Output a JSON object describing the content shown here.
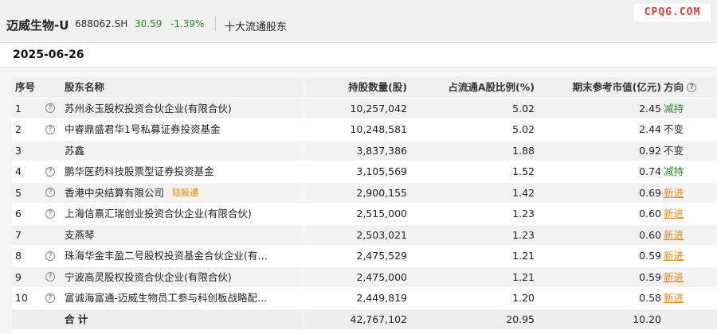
{
  "header": {
    "name": "迈威生物-U",
    "code": "688062.SH",
    "price": "30.59",
    "change_pct": "-1.39%",
    "section": "十大流通股东",
    "watermark": "CPQG.COM"
  },
  "report_date": "2025-06-26",
  "columns": {
    "index": "序号",
    "holder": "股东名称",
    "shares": "持股数量(股)",
    "ratio": "占流通A股比例(%)",
    "value": "期末参考市值(亿元)",
    "direction": "方向"
  },
  "rows": [
    {
      "index": "1",
      "holder": "苏州永玉股权投资合伙企业(有限合伙)",
      "shares": "10,257,042",
      "ratio": "5.02",
      "value": "2.45",
      "direction": "减持",
      "dir_type": "down",
      "has_help": true,
      "tag": ""
    },
    {
      "index": "2",
      "holder": "中睿鼎盛君华1号私募证券投资基金",
      "shares": "10,248,581",
      "ratio": "5.02",
      "value": "2.44",
      "direction": "不变",
      "dir_type": "same",
      "has_help": true,
      "tag": ""
    },
    {
      "index": "3",
      "holder": "苏鑫",
      "shares": "3,837,386",
      "ratio": "1.88",
      "value": "0.92",
      "direction": "不变",
      "dir_type": "same",
      "has_help": false,
      "tag": ""
    },
    {
      "index": "4",
      "holder": "鹏华医药科技股票型证券投资基金",
      "shares": "3,105,569",
      "ratio": "1.52",
      "value": "0.74",
      "direction": "减持",
      "dir_type": "down",
      "has_help": true,
      "tag": ""
    },
    {
      "index": "5",
      "holder": "香港中央结算有限公司",
      "shares": "2,900,155",
      "ratio": "1.42",
      "value": "0.69",
      "direction": "新进",
      "dir_type": "new",
      "has_help": true,
      "tag": "陆股通"
    },
    {
      "index": "6",
      "holder": "上海信熹汇瑞创业投资合伙企业(有限合伙)",
      "shares": "2,515,000",
      "ratio": "1.23",
      "value": "0.60",
      "direction": "新进",
      "dir_type": "new",
      "has_help": true,
      "tag": ""
    },
    {
      "index": "7",
      "holder": "支燕琴",
      "shares": "2,503,021",
      "ratio": "1.23",
      "value": "0.60",
      "direction": "新进",
      "dir_type": "new",
      "has_help": false,
      "tag": ""
    },
    {
      "index": "8",
      "holder": "珠海华金丰盈二号股权投资基金合伙企业(有…",
      "shares": "2,475,529",
      "ratio": "1.21",
      "value": "0.59",
      "direction": "新进",
      "dir_type": "new",
      "has_help": true,
      "tag": ""
    },
    {
      "index": "9",
      "holder": "宁波高灵股权投资合伙企业(有限合伙)",
      "shares": "2,475,000",
      "ratio": "1.21",
      "value": "0.59",
      "direction": "新进",
      "dir_type": "new",
      "has_help": true,
      "tag": ""
    },
    {
      "index": "10",
      "holder": "富诚海富通-迈威生物员工参与科创板战略配…",
      "shares": "2,449,819",
      "ratio": "1.20",
      "value": "0.58",
      "direction": "新进",
      "dir_type": "new",
      "has_help": true,
      "tag": ""
    }
  ],
  "total": {
    "label": "合 计",
    "shares": "42,767,102",
    "ratio": "20.95",
    "value": "10.20"
  },
  "colors": {
    "down": "#2a8a2a",
    "new": "#e8891a",
    "brand_watermark": "#e03c3c"
  }
}
